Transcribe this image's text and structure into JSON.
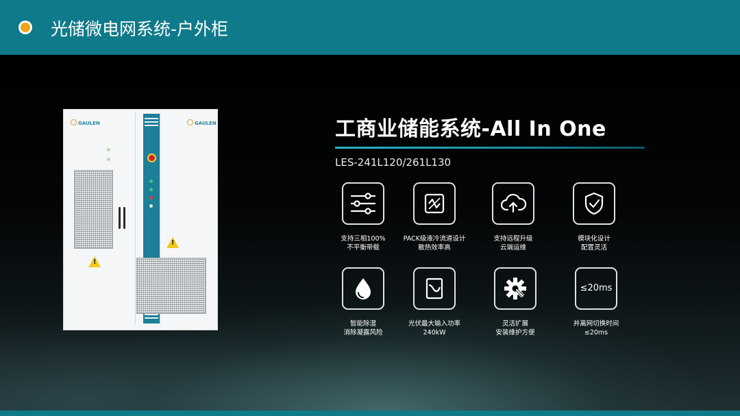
{
  "header": {
    "title": "光储微电网系统-户外柜"
  },
  "product": {
    "title": "工商业储能系统-All In One",
    "model": "LES-241L120/261L130",
    "brand_logo": "GAULEN"
  },
  "features": [
    {
      "icon": "sliders-icon",
      "line1": "支持三相100%",
      "line2": "不平衡带载"
    },
    {
      "icon": "liquid-cooling-pack-icon",
      "line1": "PACK级液冷流道设计",
      "line2": "散热效率高"
    },
    {
      "icon": "cloud-upload-icon",
      "line1": "支持远程升级",
      "line2": "云端运维"
    },
    {
      "icon": "shield-check-icon",
      "line1": "模块化设计",
      "line2": "配置灵活"
    },
    {
      "icon": "water-drop-icon",
      "line1": "智能除湿",
      "line2": "消除凝露风险"
    },
    {
      "icon": "pv-power-icon",
      "line1": "光伏最大输入功率",
      "line2": "240kW"
    },
    {
      "icon": "gear-wrench-icon",
      "line1": "灵活扩展",
      "line2": "安装维护方便"
    },
    {
      "icon": "switch-time-text",
      "box_text": "≤20ms",
      "line1": "并离网切换时间",
      "line2": "≤20ms"
    }
  ],
  "colors": {
    "header_bg": "#0f7a8a",
    "accent": "#f2a51c",
    "underline": "#2ab3c8"
  }
}
